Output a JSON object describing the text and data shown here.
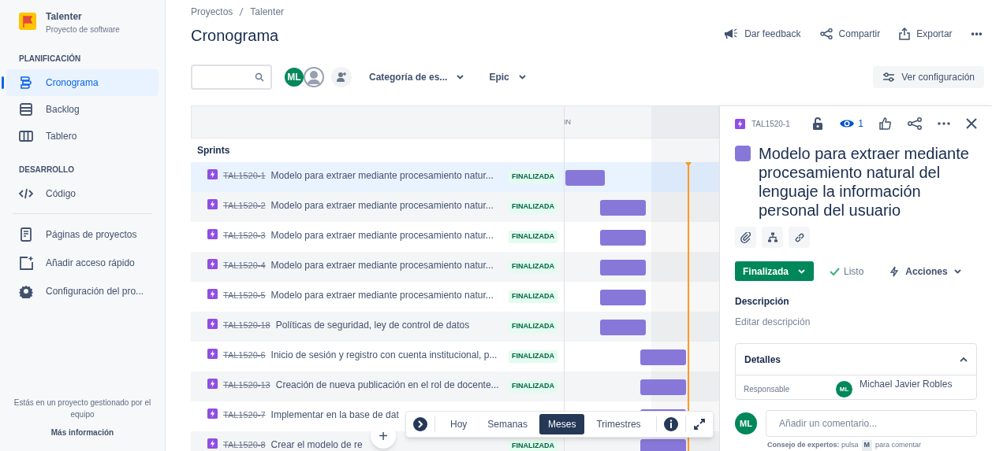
{
  "project": {
    "name": "Talenter",
    "type": "Proyecto de software"
  },
  "sidebar": {
    "sections": [
      {
        "heading": "PLANIFICACIÓN",
        "items": [
          {
            "label": "Cronograma",
            "selected": true
          },
          {
            "label": "Backlog",
            "selected": false
          },
          {
            "label": "Tablero",
            "selected": false
          }
        ]
      },
      {
        "heading": "DESARROLLO",
        "items": [
          {
            "label": "Código",
            "selected": false
          }
        ]
      }
    ],
    "links": [
      "Páginas de proyectos",
      "Añadir acceso rápido",
      "Configuración del pro..."
    ],
    "footer": {
      "text": "Estás en un proyecto gestionado por el equipo",
      "link": "Más información"
    }
  },
  "breadcrumb": [
    "Proyectos",
    "Talenter"
  ],
  "title": "Cronograma",
  "actions": [
    {
      "label": "Dar feedback",
      "kind": "feedback"
    },
    {
      "label": "Compartir",
      "kind": "share"
    },
    {
      "label": "Exportar",
      "kind": "export"
    },
    {
      "label": "•••",
      "kind": "more"
    }
  ],
  "toolbar": {
    "avatar": "ML",
    "filters": [
      "Categoría de es...",
      "Epic"
    ],
    "settings": "Ver configuración"
  },
  "timeline": {
    "header_label": "IN",
    "group": "Sprints",
    "rows": [
      {
        "key": "TAL1520-1",
        "title": "Modelo para extraer mediante procesamiento natur...",
        "status": "FINALIZADA",
        "selected": true
      },
      {
        "key": "TAL1520-2",
        "title": "Modelo para extraer mediante procesamiento natur...",
        "status": "FINALIZADA",
        "selected": false
      },
      {
        "key": "TAL1520-3",
        "title": "Modelo para extraer mediante procesamiento natur...",
        "status": "FINALIZADA",
        "selected": false
      },
      {
        "key": "TAL1520-4",
        "title": "Modelo para extraer mediante procesamiento natur...",
        "status": "FINALIZADA",
        "selected": false
      },
      {
        "key": "TAL1520-5",
        "title": "Modelo para extraer mediante procesamiento natur...",
        "status": "FINALIZADA",
        "selected": false
      },
      {
        "key": "TAL1520-18",
        "title": "Políticas de seguridad, ley de control de datos",
        "status": "FINALIZADA",
        "selected": false
      },
      {
        "key": "TAL1520-6",
        "title": "Inicio de sesión y registro con cuenta institucional, p...",
        "status": "FINALIZADA",
        "selected": false
      },
      {
        "key": "TAL1520-13",
        "title": "Creación de nueva publicación en el rol de docente...",
        "status": "FINALIZADA",
        "selected": false
      },
      {
        "key": "TAL1520-7",
        "title": "Implementar en la base de dat",
        "selected": false
      },
      {
        "key": "TAL1520-8",
        "title": "Crear el modelo de re",
        "status": "FINALIZADA",
        "selected": false
      }
    ],
    "zoom": [
      {
        "label": "Hoy",
        "selected": false
      },
      {
        "label": "Semanas",
        "selected": false
      },
      {
        "label": "Meses",
        "selected": true
      },
      {
        "label": "Trimestres",
        "selected": false
      }
    ],
    "add": "+"
  },
  "detail": {
    "key": "TAL1520-1",
    "watchers": "1",
    "title": "Modelo para extraer mediante procesamiento natural del lenguaje la información personal del usuario",
    "status": "Finalizada",
    "resolution": "Listo",
    "actions": "Acciones",
    "description_label": "Descripción",
    "description_placeholder": "Editar descripción",
    "details_heading": "Detalles",
    "field_label": "Responsable",
    "assignee_avatar": "ML",
    "assignee": "Michael Javier Robles",
    "comment_avatar": "ML",
    "comment_placeholder": "Añadir un comentario...",
    "tip": "**Consejo de expertos:** pulsa",
    "tip_key": "M",
    "tip_end": "para comentar"
  }
}
